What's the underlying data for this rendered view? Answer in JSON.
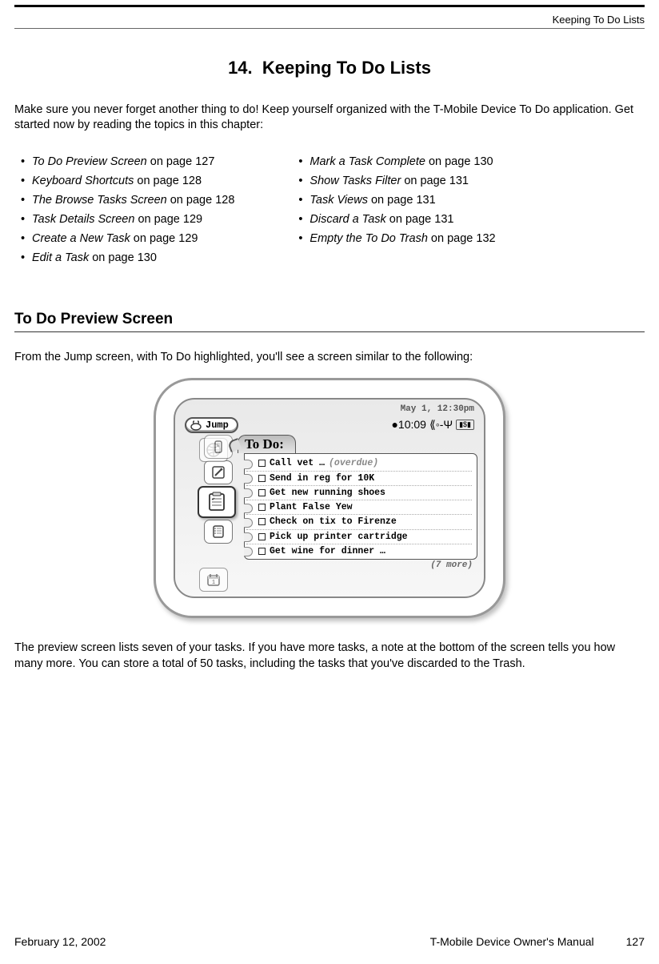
{
  "running_head": "Keeping To Do Lists",
  "chapter_number": "14.",
  "chapter_title": "Keeping To Do Lists",
  "intro": "Make sure you never forget another thing to do! Keep yourself organized with the T-Mobile Device To Do application. Get started now by reading the topics in this chapter:",
  "toc_left": [
    {
      "topic": "To Do Preview Screen",
      "page": "127"
    },
    {
      "topic": "Keyboard Shortcuts",
      "page": "128"
    },
    {
      "topic": "The Browse Tasks Screen",
      "page": "128"
    },
    {
      "topic": "Task Details Screen",
      "page": "129"
    },
    {
      "topic": "Create a New Task",
      "page": "129"
    },
    {
      "topic": "Edit a Task",
      "page": "130"
    }
  ],
  "toc_right": [
    {
      "topic": "Mark a Task Complete",
      "page": "130"
    },
    {
      "topic": "Show Tasks Filter",
      "page": "131"
    },
    {
      "topic": "Task Views",
      "page": "131"
    },
    {
      "topic": "Discard a Task",
      "page": "131"
    },
    {
      "topic": "Empty the To Do Trash",
      "page": "132"
    }
  ],
  "section_heading": "To Do Preview Screen",
  "para_before_figure": "From the Jump screen, with To Do highlighted, you'll see a screen similar to the following:",
  "device": {
    "status_date": "May 1, 12:30pm",
    "status_clock": "10:09",
    "jump_label": "Jump",
    "todo_tab": "To Do:",
    "tasks": [
      {
        "text": "Call vet …",
        "suffix": "(overdue)"
      },
      {
        "text": "Send in reg for 10K",
        "suffix": ""
      },
      {
        "text": "Get new running shoes",
        "suffix": ""
      },
      {
        "text": "Plant False Yew",
        "suffix": ""
      },
      {
        "text": "Check on tix to Firenze",
        "suffix": ""
      },
      {
        "text": "Pick up printer cartridge",
        "suffix": ""
      },
      {
        "text": "Get wine for dinner …",
        "suffix": ""
      }
    ],
    "more_note": "(7 more)"
  },
  "para_after_figure": "The preview screen lists seven of your tasks. If you have more tasks, a note at the bottom of the screen tells you how many more. You can store a total of 50 tasks, including the tasks that you've discarded to the Trash.",
  "footer": {
    "date": "February 12, 2002",
    "manual": "T-Mobile Device Owner's Manual",
    "page": "127"
  }
}
